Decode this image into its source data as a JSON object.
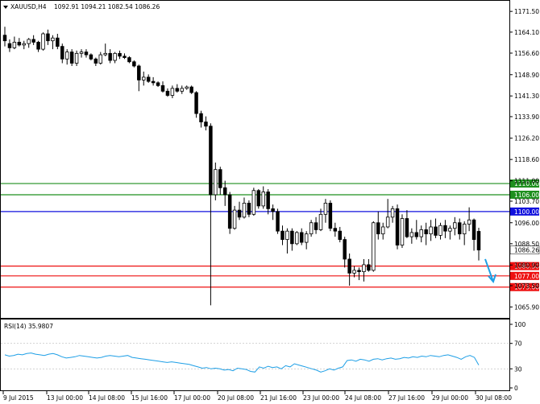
{
  "chart_data": [
    {
      "type": "candlestick",
      "symbol_label": "XAUUSD,H4",
      "ohlc_label": "1092.91 1094.21 1082.54 1086.26",
      "current_price_label": "1086.26",
      "ylim": [
        1062,
        1175
      ],
      "y_ticks": [
        "1171.50",
        "1164.10",
        "1156.60",
        "1148.90",
        "1141.30",
        "1133.90",
        "1126.20",
        "1118.60",
        "1111.00",
        "1103.70",
        "1096.00",
        "1088.50",
        "1080.90",
        "1073.50",
        "1065.90"
      ],
      "x_ticks": [
        "9 Jul 2015",
        "13 Jul 00:00",
        "14 Jul 08:00",
        "15 Jul 16:00",
        "17 Jul 00:00",
        "20 Jul 08:00",
        "21 Jul 16:00",
        "23 Jul 00:00",
        "24 Jul 08:00",
        "27 Jul 16:00",
        "29 Jul 00:00",
        "30 Jul 08:00"
      ],
      "candles": [
        {
          "o": 1163.0,
          "h": 1166.0,
          "l": 1159.0,
          "c": 1161.0
        },
        {
          "o": 1160.0,
          "h": 1161.5,
          "l": 1157.0,
          "c": 1158.5
        },
        {
          "o": 1158.5,
          "h": 1162.5,
          "l": 1158.0,
          "c": 1160.5
        },
        {
          "o": 1160.5,
          "h": 1162.0,
          "l": 1159.0,
          "c": 1159.5
        },
        {
          "o": 1159.5,
          "h": 1161.0,
          "l": 1158.0,
          "c": 1160.0
        },
        {
          "o": 1160.0,
          "h": 1162.0,
          "l": 1158.5,
          "c": 1161.5
        },
        {
          "o": 1161.5,
          "h": 1163.0,
          "l": 1159.5,
          "c": 1160.5
        },
        {
          "o": 1160.5,
          "h": 1161.0,
          "l": 1157.0,
          "c": 1158.0
        },
        {
          "o": 1158.0,
          "h": 1164.0,
          "l": 1157.5,
          "c": 1163.5
        },
        {
          "o": 1163.5,
          "h": 1165.0,
          "l": 1159.5,
          "c": 1161.0
        },
        {
          "o": 1161.0,
          "h": 1163.0,
          "l": 1158.0,
          "c": 1162.0
        },
        {
          "o": 1162.0,
          "h": 1163.5,
          "l": 1158.0,
          "c": 1159.0
        },
        {
          "o": 1159.0,
          "h": 1160.0,
          "l": 1153.0,
          "c": 1154.5
        },
        {
          "o": 1154.5,
          "h": 1158.0,
          "l": 1152.5,
          "c": 1157.0
        },
        {
          "o": 1157.0,
          "h": 1158.0,
          "l": 1152.0,
          "c": 1153.0
        },
        {
          "o": 1153.0,
          "h": 1157.5,
          "l": 1152.0,
          "c": 1156.5
        },
        {
          "o": 1156.5,
          "h": 1158.0,
          "l": 1155.0,
          "c": 1157.0
        },
        {
          "o": 1157.0,
          "h": 1158.0,
          "l": 1155.0,
          "c": 1156.0
        },
        {
          "o": 1156.0,
          "h": 1156.5,
          "l": 1154.0,
          "c": 1154.5
        },
        {
          "o": 1154.5,
          "h": 1155.0,
          "l": 1152.0,
          "c": 1153.0
        },
        {
          "o": 1153.0,
          "h": 1157.0,
          "l": 1152.5,
          "c": 1156.0
        },
        {
          "o": 1156.0,
          "h": 1160.0,
          "l": 1155.5,
          "c": 1156.5
        },
        {
          "o": 1156.5,
          "h": 1158.0,
          "l": 1153.0,
          "c": 1154.0
        },
        {
          "o": 1154.0,
          "h": 1157.0,
          "l": 1153.0,
          "c": 1156.5
        },
        {
          "o": 1156.5,
          "h": 1157.5,
          "l": 1154.5,
          "c": 1155.5
        },
        {
          "o": 1155.5,
          "h": 1156.5,
          "l": 1154.5,
          "c": 1155.0
        },
        {
          "o": 1155.0,
          "h": 1155.5,
          "l": 1153.0,
          "c": 1153.5
        },
        {
          "o": 1153.5,
          "h": 1154.0,
          "l": 1151.5,
          "c": 1152.0
        },
        {
          "o": 1152.0,
          "h": 1152.5,
          "l": 1143.0,
          "c": 1147.0
        },
        {
          "o": 1147.0,
          "h": 1150.0,
          "l": 1145.0,
          "c": 1148.0
        },
        {
          "o": 1148.0,
          "h": 1149.0,
          "l": 1146.0,
          "c": 1146.5
        },
        {
          "o": 1146.5,
          "h": 1148.0,
          "l": 1145.0,
          "c": 1146.0
        },
        {
          "o": 1146.0,
          "h": 1146.5,
          "l": 1144.5,
          "c": 1145.0
        },
        {
          "o": 1145.0,
          "h": 1146.5,
          "l": 1142.5,
          "c": 1143.0
        },
        {
          "o": 1143.0,
          "h": 1144.0,
          "l": 1141.0,
          "c": 1141.5
        },
        {
          "o": 1141.5,
          "h": 1145.0,
          "l": 1140.5,
          "c": 1144.0
        },
        {
          "o": 1144.0,
          "h": 1145.5,
          "l": 1142.5,
          "c": 1143.0
        },
        {
          "o": 1143.0,
          "h": 1145.0,
          "l": 1142.0,
          "c": 1144.0
        },
        {
          "o": 1144.0,
          "h": 1145.0,
          "l": 1143.5,
          "c": 1144.5
        },
        {
          "o": 1144.5,
          "h": 1145.0,
          "l": 1142.0,
          "c": 1142.5
        },
        {
          "o": 1142.5,
          "h": 1143.0,
          "l": 1133.5,
          "c": 1135.0
        },
        {
          "o": 1135.0,
          "h": 1136.0,
          "l": 1130.0,
          "c": 1132.0
        },
        {
          "o": 1132.0,
          "h": 1134.0,
          "l": 1129.0,
          "c": 1130.5
        },
        {
          "o": 1130.5,
          "h": 1131.5,
          "l": 1066.5,
          "c": 1106.0
        },
        {
          "o": 1106.0,
          "h": 1117.5,
          "l": 1104.0,
          "c": 1115.0
        },
        {
          "o": 1115.0,
          "h": 1116.0,
          "l": 1106.0,
          "c": 1108.5
        },
        {
          "o": 1108.5,
          "h": 1111.0,
          "l": 1102.0,
          "c": 1106.0
        },
        {
          "o": 1106.0,
          "h": 1107.0,
          "l": 1092.0,
          "c": 1094.0
        },
        {
          "o": 1094.0,
          "h": 1102.0,
          "l": 1093.5,
          "c": 1100.5
        },
        {
          "o": 1100.5,
          "h": 1103.5,
          "l": 1097.0,
          "c": 1098.0
        },
        {
          "o": 1098.0,
          "h": 1105.0,
          "l": 1097.5,
          "c": 1103.0
        },
        {
          "o": 1103.0,
          "h": 1104.0,
          "l": 1098.0,
          "c": 1099.0
        },
        {
          "o": 1099.0,
          "h": 1108.5,
          "l": 1098.5,
          "c": 1107.5
        },
        {
          "o": 1107.5,
          "h": 1108.0,
          "l": 1101.0,
          "c": 1102.0
        },
        {
          "o": 1102.0,
          "h": 1109.0,
          "l": 1101.0,
          "c": 1107.0
        },
        {
          "o": 1107.0,
          "h": 1108.0,
          "l": 1099.0,
          "c": 1101.0
        },
        {
          "o": 1101.0,
          "h": 1102.5,
          "l": 1097.0,
          "c": 1100.0
        },
        {
          "o": 1100.0,
          "h": 1101.0,
          "l": 1092.0,
          "c": 1093.0
        },
        {
          "o": 1093.0,
          "h": 1095.0,
          "l": 1088.0,
          "c": 1090.0
        },
        {
          "o": 1090.0,
          "h": 1094.0,
          "l": 1085.0,
          "c": 1093.0
        },
        {
          "o": 1093.0,
          "h": 1094.0,
          "l": 1086.0,
          "c": 1088.5
        },
        {
          "o": 1088.5,
          "h": 1093.0,
          "l": 1088.0,
          "c": 1092.5
        },
        {
          "o": 1092.5,
          "h": 1094.0,
          "l": 1088.0,
          "c": 1089.0
        },
        {
          "o": 1089.0,
          "h": 1093.0,
          "l": 1086.5,
          "c": 1092.0
        },
        {
          "o": 1092.0,
          "h": 1097.0,
          "l": 1091.0,
          "c": 1096.0
        },
        {
          "o": 1096.0,
          "h": 1098.0,
          "l": 1092.0,
          "c": 1093.5
        },
        {
          "o": 1093.5,
          "h": 1101.0,
          "l": 1093.0,
          "c": 1099.0
        },
        {
          "o": 1099.0,
          "h": 1104.5,
          "l": 1096.0,
          "c": 1103.0
        },
        {
          "o": 1103.0,
          "h": 1104.0,
          "l": 1093.0,
          "c": 1094.0
        },
        {
          "o": 1094.0,
          "h": 1096.0,
          "l": 1091.0,
          "c": 1093.0
        },
        {
          "o": 1093.0,
          "h": 1094.5,
          "l": 1089.0,
          "c": 1090.0
        },
        {
          "o": 1090.0,
          "h": 1091.0,
          "l": 1080.0,
          "c": 1083.0
        },
        {
          "o": 1083.0,
          "h": 1085.0,
          "l": 1073.5,
          "c": 1078.0
        },
        {
          "o": 1078.0,
          "h": 1080.5,
          "l": 1076.5,
          "c": 1079.0
        },
        {
          "o": 1079.0,
          "h": 1080.0,
          "l": 1075.5,
          "c": 1078.5
        },
        {
          "o": 1078.5,
          "h": 1083.0,
          "l": 1075.0,
          "c": 1081.0
        },
        {
          "o": 1081.0,
          "h": 1083.0,
          "l": 1078.5,
          "c": 1079.0
        },
        {
          "o": 1079.0,
          "h": 1096.5,
          "l": 1078.5,
          "c": 1096.0
        },
        {
          "o": 1096.0,
          "h": 1100.0,
          "l": 1090.0,
          "c": 1092.0
        },
        {
          "o": 1092.0,
          "h": 1096.0,
          "l": 1090.0,
          "c": 1094.5
        },
        {
          "o": 1094.5,
          "h": 1104.5,
          "l": 1094.0,
          "c": 1098.0
        },
        {
          "o": 1098.0,
          "h": 1102.0,
          "l": 1096.0,
          "c": 1101.0
        },
        {
          "o": 1101.0,
          "h": 1102.5,
          "l": 1086.5,
          "c": 1088.0
        },
        {
          "o": 1088.0,
          "h": 1099.0,
          "l": 1087.0,
          "c": 1097.5
        },
        {
          "o": 1097.5,
          "h": 1100.5,
          "l": 1090.5,
          "c": 1091.0
        },
        {
          "o": 1091.0,
          "h": 1094.0,
          "l": 1088.5,
          "c": 1092.5
        },
        {
          "o": 1092.5,
          "h": 1097.0,
          "l": 1090.0,
          "c": 1091.0
        },
        {
          "o": 1091.0,
          "h": 1095.0,
          "l": 1089.0,
          "c": 1093.5
        },
        {
          "o": 1093.5,
          "h": 1096.0,
          "l": 1088.0,
          "c": 1092.0
        },
        {
          "o": 1092.0,
          "h": 1097.0,
          "l": 1089.5,
          "c": 1094.5
        },
        {
          "o": 1094.5,
          "h": 1097.5,
          "l": 1090.5,
          "c": 1091.5
        },
        {
          "o": 1091.5,
          "h": 1096.0,
          "l": 1090.0,
          "c": 1095.0
        },
        {
          "o": 1095.0,
          "h": 1097.0,
          "l": 1090.5,
          "c": 1093.0
        },
        {
          "o": 1093.0,
          "h": 1095.0,
          "l": 1090.0,
          "c": 1094.0
        },
        {
          "o": 1094.0,
          "h": 1098.0,
          "l": 1091.5,
          "c": 1096.0
        },
        {
          "o": 1096.0,
          "h": 1097.5,
          "l": 1090.0,
          "c": 1092.0
        },
        {
          "o": 1092.0,
          "h": 1096.5,
          "l": 1088.0,
          "c": 1095.5
        },
        {
          "o": 1095.5,
          "h": 1101.5,
          "l": 1093.0,
          "c": 1097.0
        },
        {
          "o": 1097.0,
          "h": 1097.5,
          "l": 1086.0,
          "c": 1090.0
        },
        {
          "o": 1092.91,
          "h": 1094.21,
          "l": 1082.54,
          "c": 1086.26
        }
      ],
      "levels": [
        {
          "value": 1110.0,
          "label": "1110.00",
          "color": "#1e8f1e"
        },
        {
          "value": 1106.0,
          "label": "1106.00",
          "color": "#1e8f1e"
        },
        {
          "value": 1100.0,
          "label": "1100.00",
          "color": "#1010dd"
        },
        {
          "value": 1080.5,
          "label": "1080.50",
          "color": "#ee1111"
        },
        {
          "value": 1077.0,
          "label": "1077.00",
          "color": "#ee1111"
        },
        {
          "value": 1073.0,
          "label": "1073.00",
          "color": "#ee1111"
        }
      ],
      "arrow_color": "#1e9fe6",
      "up_candle_color": "#ffffff",
      "down_candle_color": "#000000"
    },
    {
      "type": "line",
      "indicator_label": "RSI(14) 35.9807",
      "ylim": [
        0,
        100
      ],
      "y_ticks": [
        "100",
        "70",
        "30",
        "0"
      ],
      "line_color": "#1e9fe6",
      "values": [
        52,
        50,
        51,
        53,
        52,
        54,
        55,
        53,
        52,
        51,
        53,
        54,
        52,
        49,
        47,
        48,
        49,
        51,
        50,
        49,
        48,
        47,
        48,
        50,
        51,
        50,
        49,
        50,
        51,
        48,
        47,
        46,
        45,
        44,
        43,
        42,
        41,
        40,
        41,
        40,
        39,
        38,
        37,
        35,
        33,
        31,
        32,
        30,
        31,
        30,
        28,
        29,
        27,
        31,
        30,
        29,
        26,
        25,
        33,
        31,
        34,
        32,
        33,
        30,
        35,
        33,
        38,
        36,
        34,
        32,
        30,
        28,
        25,
        27,
        30,
        28,
        31,
        33,
        43,
        44,
        42,
        45,
        44,
        42,
        45,
        46,
        44,
        46,
        47,
        45,
        46,
        48,
        47,
        49,
        48,
        50,
        49,
        51,
        50,
        49,
        51,
        52,
        50,
        48,
        45,
        49,
        51,
        48,
        36
      ]
    }
  ]
}
